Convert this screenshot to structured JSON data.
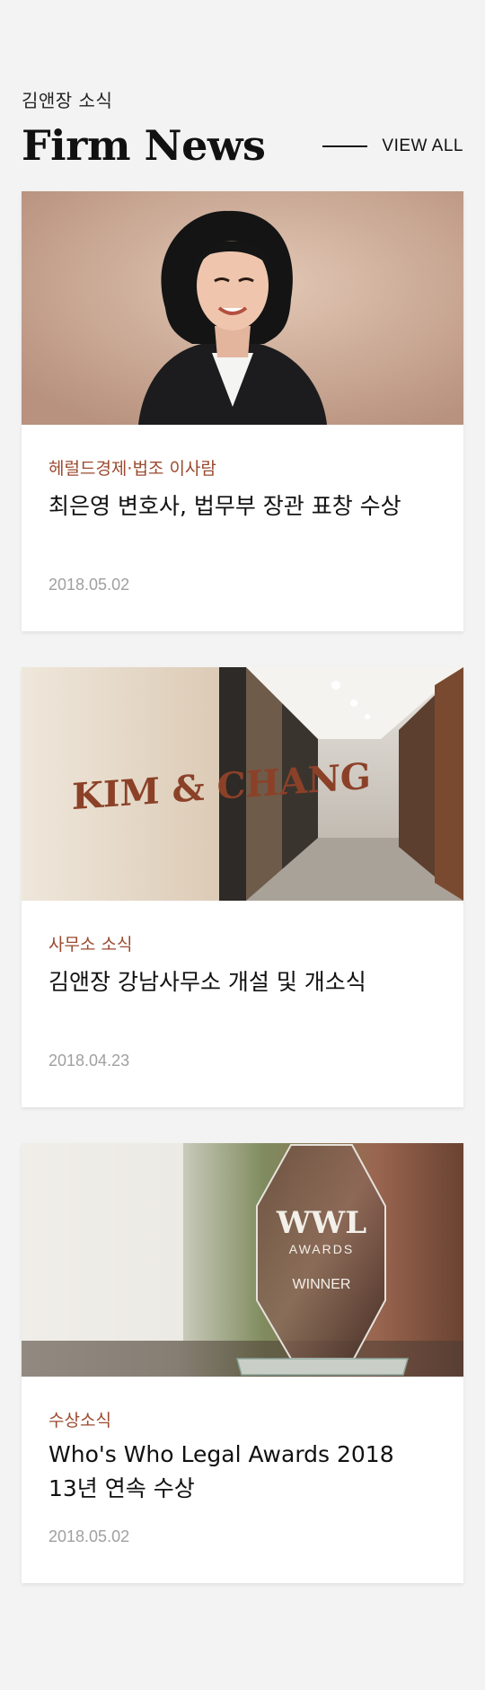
{
  "section": {
    "eyebrow": "김앤장 소식",
    "title": "Firm News",
    "view_all": "VIEW ALL"
  },
  "cards": [
    {
      "category": "헤럴드경제·법조 이사람",
      "headline": "최은영 변호사, 법무부 장관 표창 수상",
      "date": "2018.05.02"
    },
    {
      "category": "사무소 소식",
      "headline": "김앤장 강남사무소 개설 및 개소식",
      "date": "2018.04.23",
      "sign_text": "KIM & CHANG"
    },
    {
      "category": "수상소식",
      "headline_line1": "Who's Who Legal Awards 2018",
      "headline_line2": "13년 연속 수상",
      "date": "2018.05.02",
      "trophy_logo": "WWL",
      "trophy_awards": "AWARDS",
      "trophy_winner": "WINNER"
    }
  ],
  "colors": {
    "accent": "#9a4a2f",
    "background": "#f3f3f3",
    "card": "#ffffff",
    "date": "#a0a0a0"
  }
}
